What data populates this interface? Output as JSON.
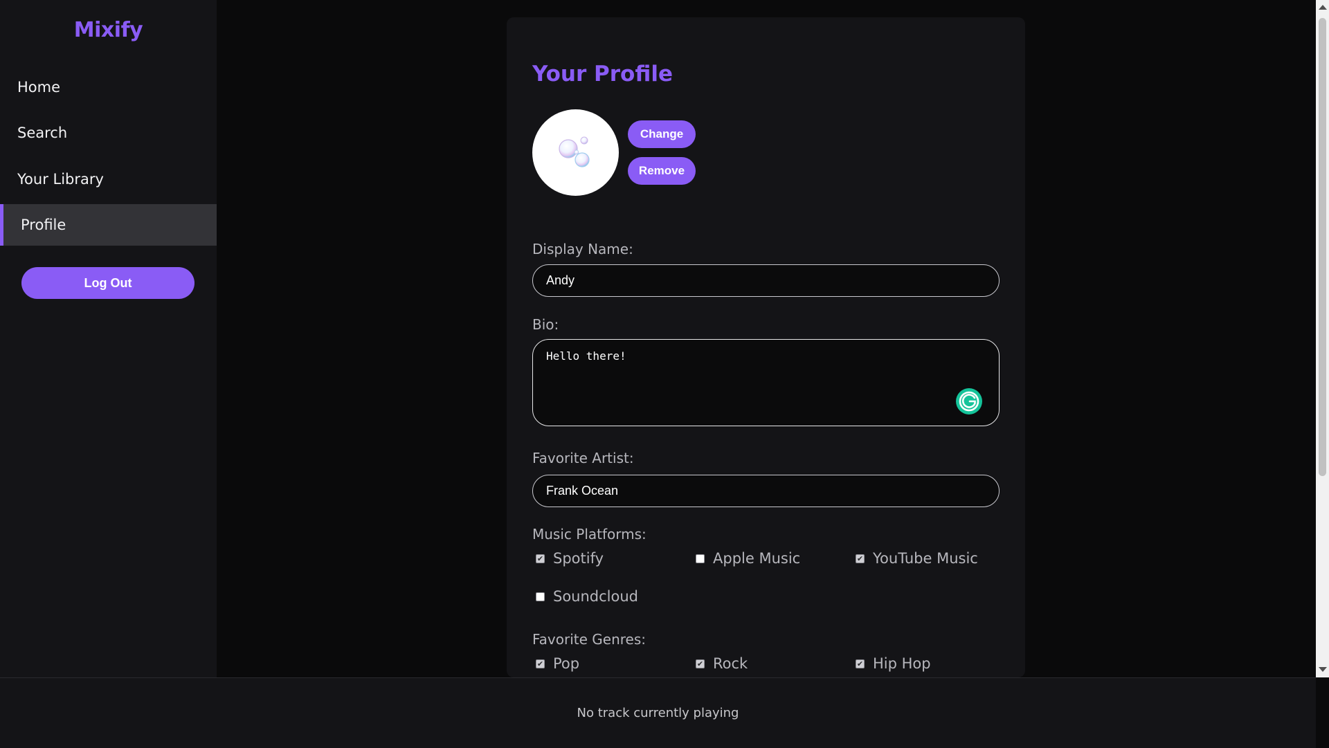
{
  "app": {
    "name": "Mixify"
  },
  "sidebar": {
    "items": [
      {
        "label": "Home"
      },
      {
        "label": "Search"
      },
      {
        "label": "Your Library"
      },
      {
        "label": "Profile",
        "active": true
      }
    ],
    "logout_label": "Log Out"
  },
  "profile": {
    "title": "Your Profile",
    "avatar_buttons": {
      "change": "Change",
      "remove": "Remove"
    },
    "display_name": {
      "label": "Display Name:",
      "value": "Andy"
    },
    "bio": {
      "label": "Bio:",
      "value": "Hello there!"
    },
    "favorite_artist": {
      "label": "Favorite Artist:",
      "value": "Frank Ocean"
    },
    "music_platforms": {
      "label": "Music Platforms:",
      "options": [
        {
          "label": "Spotify",
          "checked": true
        },
        {
          "label": "Apple Music",
          "checked": false
        },
        {
          "label": "YouTube Music",
          "checked": true
        },
        {
          "label": "Soundcloud",
          "checked": false
        }
      ]
    },
    "favorite_genres": {
      "label": "Favorite Genres:",
      "options": [
        {
          "label": "Pop",
          "checked": true
        },
        {
          "label": "Rock",
          "checked": true
        },
        {
          "label": "Hip Hop",
          "checked": true
        }
      ]
    }
  },
  "player": {
    "status": "No track currently playing"
  },
  "colors": {
    "accent": "#8a5cf5",
    "background": "#0a0a0b",
    "panel": "#141417",
    "active_nav": "#333337"
  }
}
